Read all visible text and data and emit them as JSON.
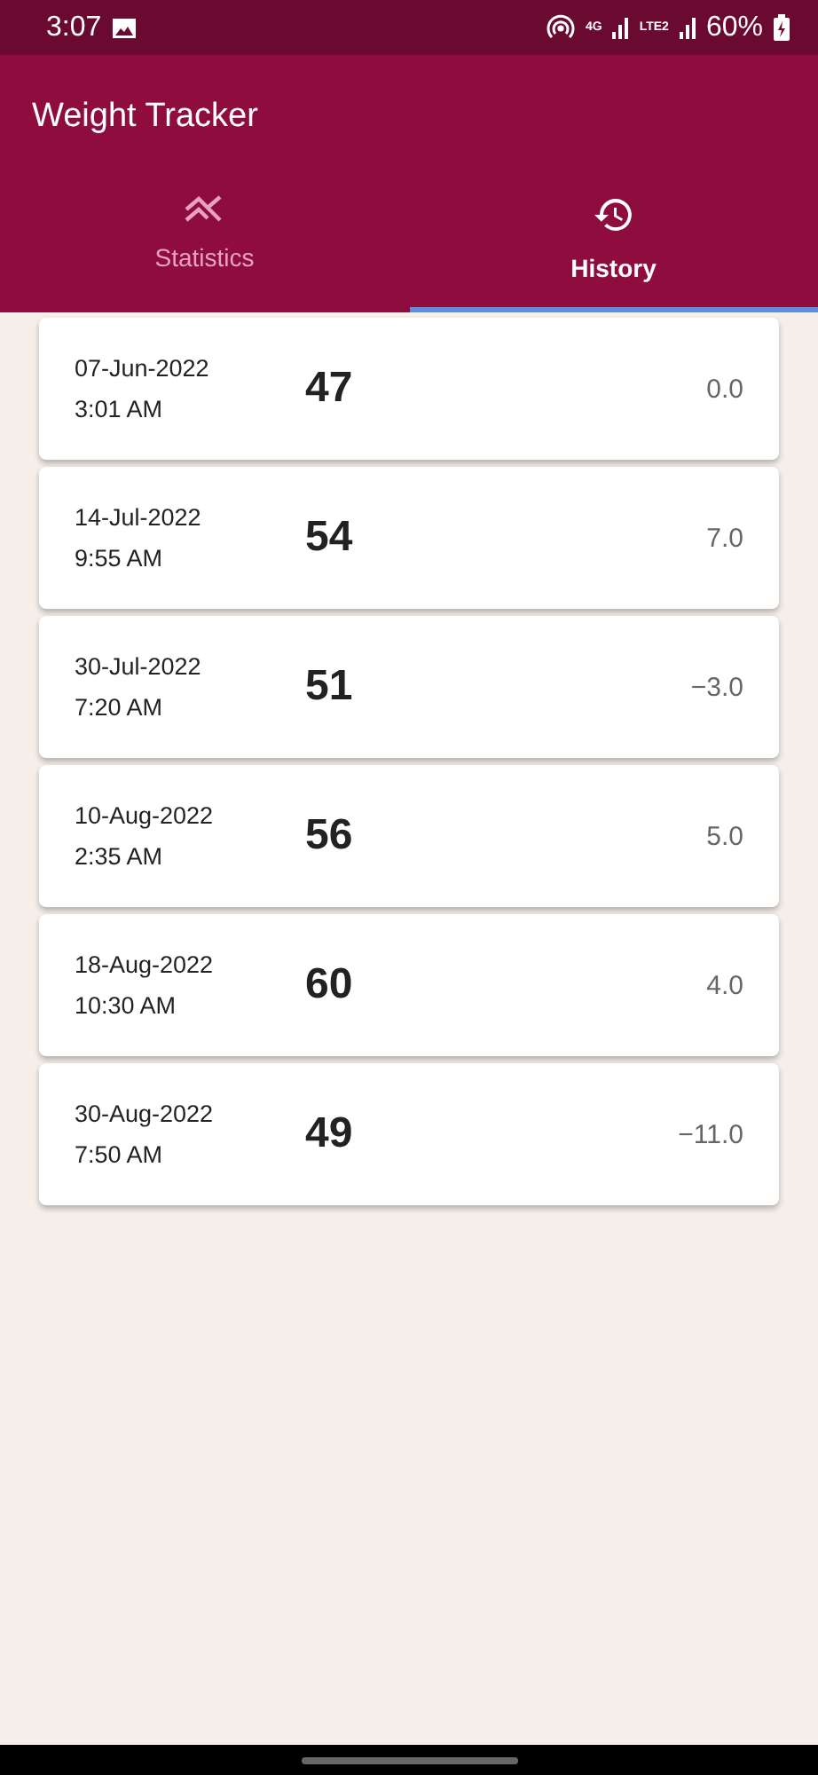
{
  "status_bar": {
    "time": "3:07",
    "network": [
      "4G",
      "LTE2"
    ],
    "battery": "60%"
  },
  "app_bar": {
    "title": "Weight Tracker"
  },
  "tabs": [
    {
      "label": "Statistics",
      "kind": "statistics",
      "selected": false
    },
    {
      "label": "History",
      "kind": "history",
      "selected": true
    }
  ],
  "entries": [
    {
      "date": "07-Jun-2022",
      "time": "3:01 AM",
      "weight": "47",
      "change": "0.0"
    },
    {
      "date": "14-Jul-2022",
      "time": "9:55 AM",
      "weight": "54",
      "change": "7.0"
    },
    {
      "date": "30-Jul-2022",
      "time": "7:20 AM",
      "weight": "51",
      "change": "−3.0"
    },
    {
      "date": "10-Aug-2022",
      "time": "2:35 AM",
      "weight": "56",
      "change": "5.0"
    },
    {
      "date": "18-Aug-2022",
      "time": "10:30 AM",
      "weight": "60",
      "change": "4.0"
    },
    {
      "date": "30-Aug-2022",
      "time": "7:50 AM",
      "weight": "49",
      "change": "−11.0"
    }
  ]
}
